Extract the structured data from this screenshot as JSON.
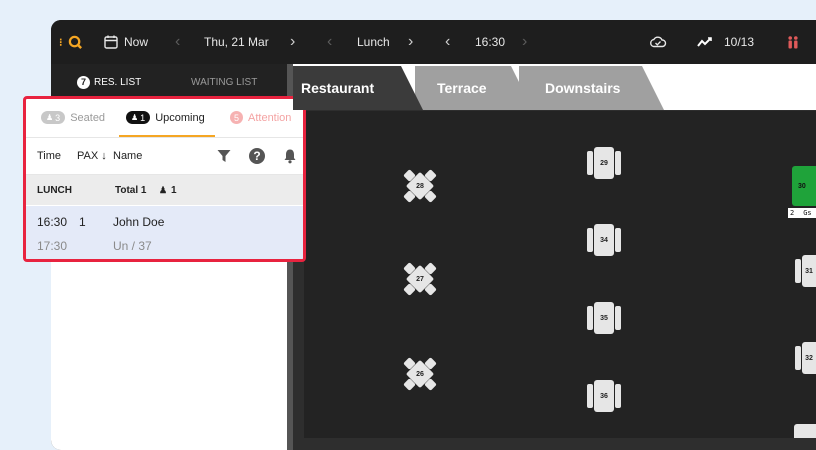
{
  "topbar": {
    "date_prefix_label": "Now",
    "date": "Thu, 21 Mar",
    "service": "Lunch",
    "time": "16:30",
    "occupancy": "10/13"
  },
  "left_tabs": {
    "res_list_count": "7",
    "res_list_label": "RES. LIST",
    "waiting_list_label": "WAITING LIST"
  },
  "areas": [
    {
      "label": "Restaurant"
    },
    {
      "label": "Terrace"
    },
    {
      "label": "Downstairs"
    }
  ],
  "overlay": {
    "tabs": {
      "seated_count": "3",
      "seated_label": "Seated",
      "upcoming_count": "1",
      "upcoming_label": "Upcoming",
      "attention_count": "5",
      "attention_label": "Attention"
    },
    "columns": {
      "time": "Time",
      "pax": "PAX",
      "pax_sort": "↓",
      "name": "Name"
    },
    "group": {
      "name": "LUNCH",
      "total_label": "Total 1",
      "total_guests": "1"
    },
    "reservation": {
      "time": "16:30",
      "pax": "1",
      "name": "John Doe",
      "end_time": "17:30",
      "table_info": "Un / 37"
    }
  },
  "tables": {
    "t29": "29",
    "t34": "34",
    "t35": "35",
    "t36": "36",
    "t28": "28",
    "t27": "27",
    "t26": "26",
    "t30": "30",
    "t31": "31",
    "t32": "32",
    "t30_pax": "2",
    "t30_guest": "Gs"
  },
  "colors": {
    "accent": "#f5a623",
    "highlight_border": "#e8233f",
    "selected_row": "#e4eaf8",
    "occupied_table": "#1fa33a"
  }
}
